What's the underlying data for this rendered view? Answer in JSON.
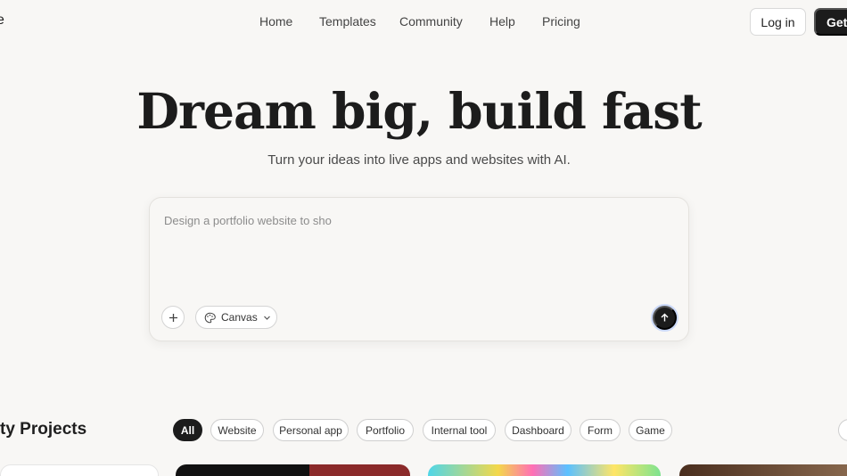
{
  "nav": {
    "logo_fragment": "e",
    "links": [
      "Home",
      "Templates",
      "Community",
      "Help",
      "Pricing"
    ],
    "login": "Log in",
    "get_started": "Get"
  },
  "hero": {
    "title": "Dream big, build fast",
    "subtitle": "Turn your ideas into live apps and websites with AI."
  },
  "prompt": {
    "value": "Design a portfolio website to sho",
    "mode_label": "Canvas"
  },
  "projects": {
    "title": "ty Projects",
    "filters": [
      "All",
      "Website",
      "Personal app",
      "Portfolio",
      "Internal tool",
      "Dashboard",
      "Form",
      "Game"
    ],
    "active_filter": "All"
  },
  "colors": {
    "background": "#f8f7f5",
    "primary_dark": "#1c1c1c",
    "chip_border": "#cfcfcf"
  },
  "icons": [
    "plus-icon",
    "palette-icon",
    "chevron-down-icon",
    "arrow-up-icon"
  ]
}
